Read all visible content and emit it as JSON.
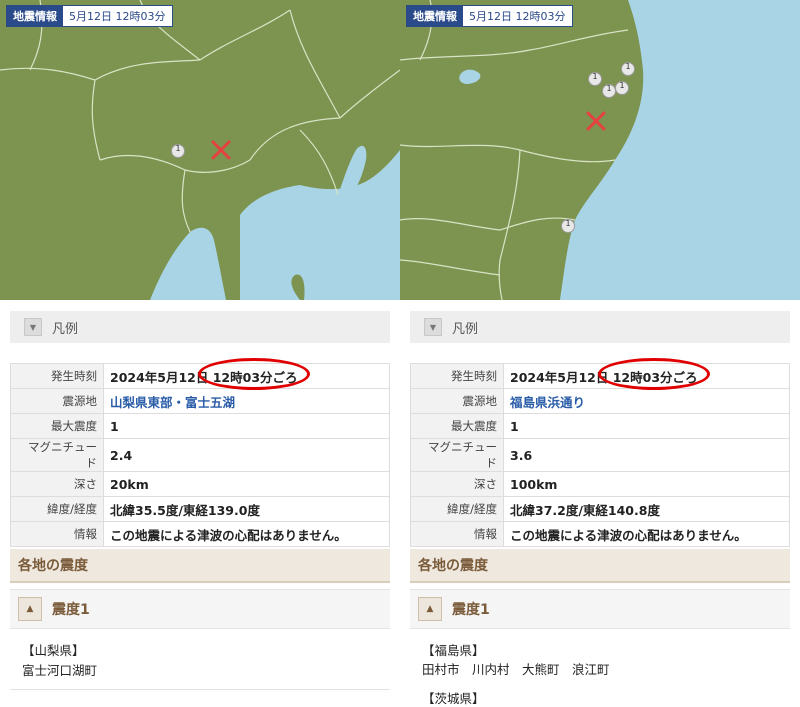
{
  "panels": [
    {
      "map": {
        "badge_label": "地震情報",
        "badge_date": "5月12日 12時03分",
        "markers": [
          {
            "label": "1"
          }
        ]
      },
      "legend": {
        "label": "凡例"
      },
      "info": {
        "rows": [
          {
            "key": "発生時刻",
            "value": "2024年5月12日 12時03分ごろ"
          },
          {
            "key": "震源地",
            "value": "山梨県東部・富士五湖"
          },
          {
            "key": "最大震度",
            "value": "1"
          },
          {
            "key": "マグニチュード",
            "value": "2.4"
          },
          {
            "key": "深さ",
            "value": "20km"
          },
          {
            "key": "緯度/経度",
            "value": "北緯35.5度/東経139.0度"
          },
          {
            "key": "情報",
            "value": "この地震による津波の心配はありません。"
          }
        ]
      },
      "section_title": "各地の震度",
      "intensity_label": "震度1",
      "regions": [
        {
          "name": "【山梨県】",
          "municipalities": "富士河口湖町"
        }
      ]
    },
    {
      "map": {
        "badge_label": "地震情報",
        "badge_date": "5月12日 12時03分",
        "markers": [
          {
            "label": "1"
          },
          {
            "label": "1"
          },
          {
            "label": "1"
          },
          {
            "label": "1"
          },
          {
            "label": "1"
          }
        ]
      },
      "legend": {
        "label": "凡例"
      },
      "info": {
        "rows": [
          {
            "key": "発生時刻",
            "value": "2024年5月12日 12時03分ごろ"
          },
          {
            "key": "震源地",
            "value": "福島県浜通り"
          },
          {
            "key": "最大震度",
            "value": "1"
          },
          {
            "key": "マグニチュード",
            "value": "3.6"
          },
          {
            "key": "深さ",
            "value": "100km"
          },
          {
            "key": "緯度/経度",
            "value": "北緯37.2度/東経140.8度"
          },
          {
            "key": "情報",
            "value": "この地震による津波の心配はありません。"
          }
        ]
      },
      "section_title": "各地の震度",
      "intensity_label": "震度1",
      "regions": [
        {
          "name": "【福島県】",
          "municipalities": "田村市　川内村　大熊町　浪江町"
        },
        {
          "name": "【茨城県】",
          "municipalities": ""
        }
      ]
    }
  ],
  "colors": {
    "land": "#7d9451",
    "sea": "#a9d4e5",
    "border": "#d8e3c4",
    "accent": "#2b4a8a",
    "epicenter": "#e64040",
    "highlight": "#e00000"
  }
}
